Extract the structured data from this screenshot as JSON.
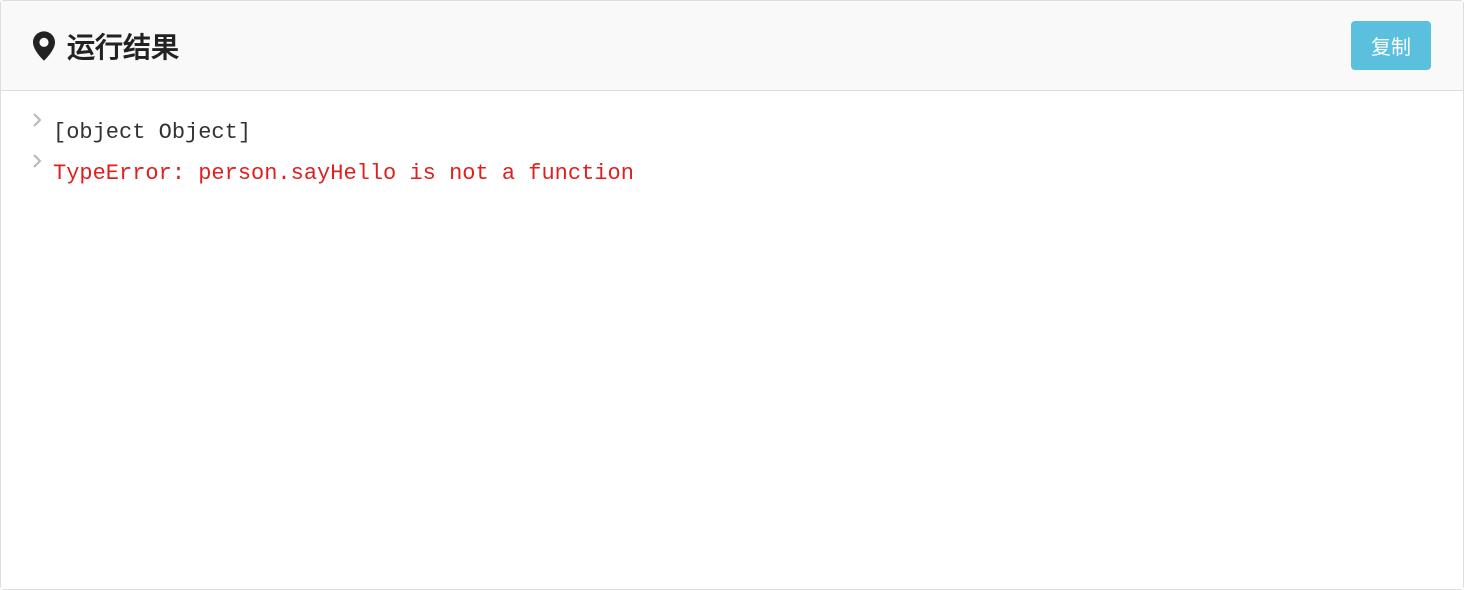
{
  "header": {
    "title": "运行结果",
    "copy_button": "复制"
  },
  "output": {
    "lines": [
      {
        "text": "[object Object]",
        "type": "log"
      },
      {
        "text": "TypeError: person.sayHello is not a function",
        "type": "error"
      }
    ]
  }
}
